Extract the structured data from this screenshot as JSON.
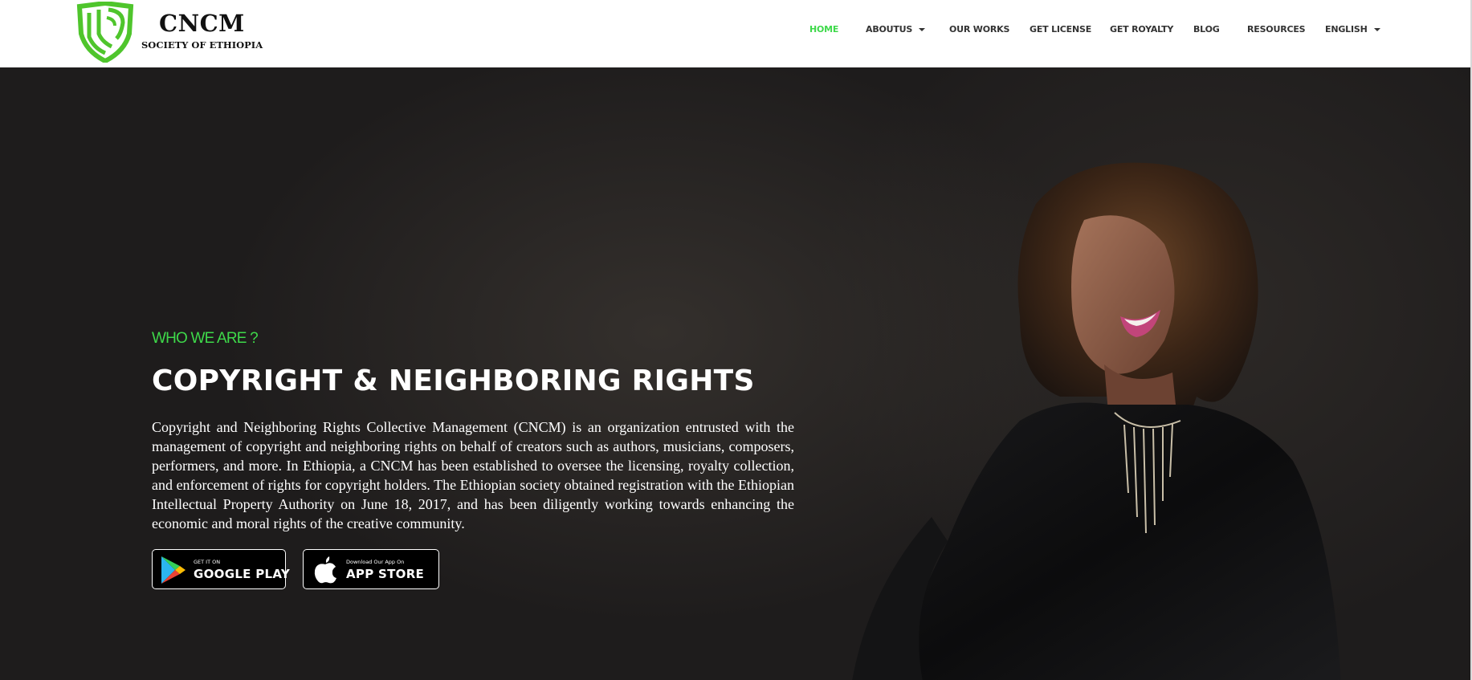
{
  "header": {
    "brand_name": "CNCM",
    "brand_sub": "SOCIETY OF ETHIOPIA",
    "nav": {
      "home": "HOME",
      "about": "ABOUTUS",
      "works": "OUR WORKS",
      "license": "GET LICENSE",
      "royalty": "GET ROYALTY",
      "blog": "BLOG",
      "resources": "RESOURCES",
      "language": "ENGLISH"
    }
  },
  "hero": {
    "eyebrow": "WHO WE ARE ?",
    "headline": "COPYRIGHT & NEIGHBORING RIGHTS",
    "description": "Copyright and Neighboring Rights Collective Management (CNCM) is an organization entrusted with the management of copyright and neighboring rights on behalf of creators such as authors, musicians, composers, performers, and more. In Ethiopia, a CNCM has been established to oversee the licensing, royalty collection, and enforcement of rights for copyright holders. The Ethiopian society obtained registration with the Ethiopian Intellectual Property Authority on June 18, 2017, and has been diligently working towards enhancing the economic and moral rights of the creative community.",
    "google_play": {
      "small": "GET IT ON",
      "big": "GOOGLE PLAY"
    },
    "app_store": {
      "small": "Download Our App On",
      "big": "APP STORE"
    }
  },
  "colors": {
    "accent_green": "#3ed94a",
    "header_bg": "#ffffff",
    "hero_bg": "#1e1c1c"
  },
  "icons": [
    "shield-logo-icon",
    "chevron-down-icon",
    "google-play-icon",
    "apple-icon"
  ]
}
